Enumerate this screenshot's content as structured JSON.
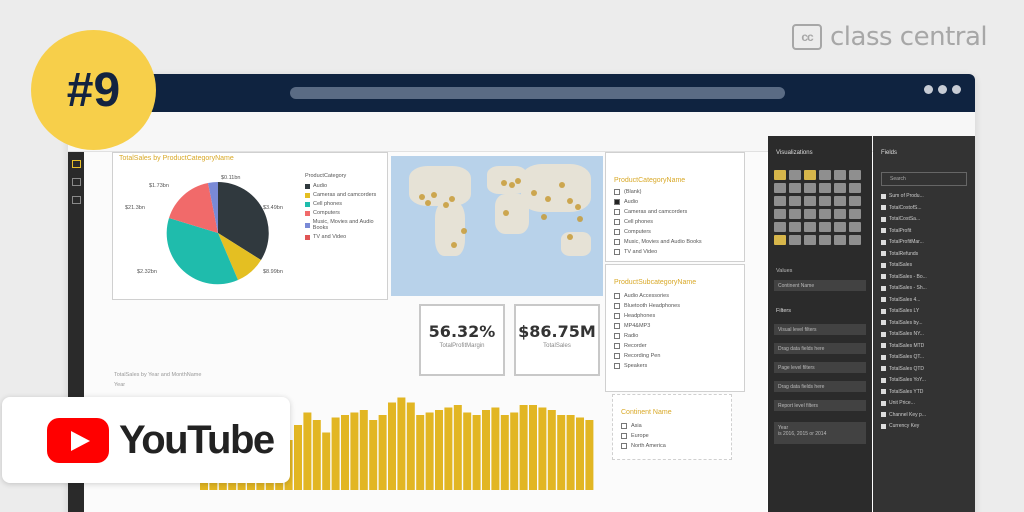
{
  "brand": {
    "logo_text": "cc",
    "name": "class central"
  },
  "badge": {
    "label": "#9"
  },
  "youtube": {
    "label": "YouTube"
  },
  "kpis": [
    {
      "value": "56.32%",
      "label": "TotalProfitMargin"
    },
    {
      "value": "$86.75M",
      "label": "TotalSales"
    }
  ],
  "pie": {
    "title": "TotalSales by ProductCategoryName",
    "legend_title": "ProductCategory",
    "legend": [
      "Audio",
      "Cameras and camcorders",
      "Cell phones",
      "Computers",
      "Music, Movies and Audio Books",
      "TV and Video"
    ],
    "labels": [
      "$1.73bn",
      "$0.11bn",
      "$21.3bn",
      "$3.49bn",
      "$2.32bn",
      "$8.99bn"
    ]
  },
  "slicers": {
    "category_title": "ProductCategoryName",
    "category_items": [
      "(Blank)",
      "Audio",
      "Cameras and camcorders",
      "Cell phones",
      "Computers",
      "Music, Movies and Audio Books",
      "TV and Video"
    ],
    "subcategory_title": "ProductSubcategoryName",
    "subcategory_items": [
      "Audio Accessories",
      "Bluetooth Headphones",
      "Headphones",
      "MP4&MP3",
      "Radio",
      "Recorder",
      "Recording Pen",
      "Speakers"
    ],
    "customer_title": "Continent Name",
    "customer_items": [
      "Asia",
      "Europe",
      "North America"
    ]
  },
  "columns_chart": {
    "title": "TotalSales by Year and MonthName",
    "legend": "Year"
  },
  "viz_pane": {
    "title": "Visualizations",
    "values_label": "Values",
    "values_field": "Continent Name",
    "filters_label": "Filters",
    "filter_rows": [
      "Visual level filters",
      "Drag data fields here",
      "Page level filters",
      "Drag data fields here",
      "Report level filters"
    ],
    "report_filter": "Year",
    "report_filter_value": "is 2016, 2015 or 2014"
  },
  "fields_pane": {
    "title": "Fields",
    "search_placeholder": "Search",
    "fields": [
      "Sum of Produ...",
      "TotalCostofS...",
      "TotalCostSa...",
      "TotalProfit",
      "TotalProfitMar...",
      "TotalRefunds",
      "TotalSales",
      "TotalSales - Bo...",
      "TotalSales - Sh...",
      "TotalSales 4...",
      "TotalSales LY",
      "TotalSales by...",
      "TotalSales NY...",
      "TotalSales MTD",
      "TotalSales QT...",
      "TotalSales QTD",
      "TotalSales YoY...",
      "TotalSales YTD",
      "Unit Price...",
      "Channel Key p...",
      "Currency Key"
    ]
  },
  "colors": {
    "accent": "#e8c02a",
    "bar": "#e2b623",
    "titlebar": "#0f2340",
    "pane": "#2b2b2b"
  },
  "chart_data": {
    "type": "bar",
    "title": "TotalSales by Year and MonthName",
    "values": [
      8,
      10,
      12,
      14,
      14,
      16,
      22,
      26,
      30,
      40,
      52,
      62,
      56,
      46,
      58,
      60,
      62,
      64,
      56,
      60,
      70,
      74,
      70,
      60,
      62,
      64,
      66,
      68,
      62,
      60,
      64,
      66,
      60,
      62,
      68,
      68,
      66,
      64,
      60,
      60,
      58,
      56
    ],
    "ylim": [
      0,
      80
    ]
  }
}
